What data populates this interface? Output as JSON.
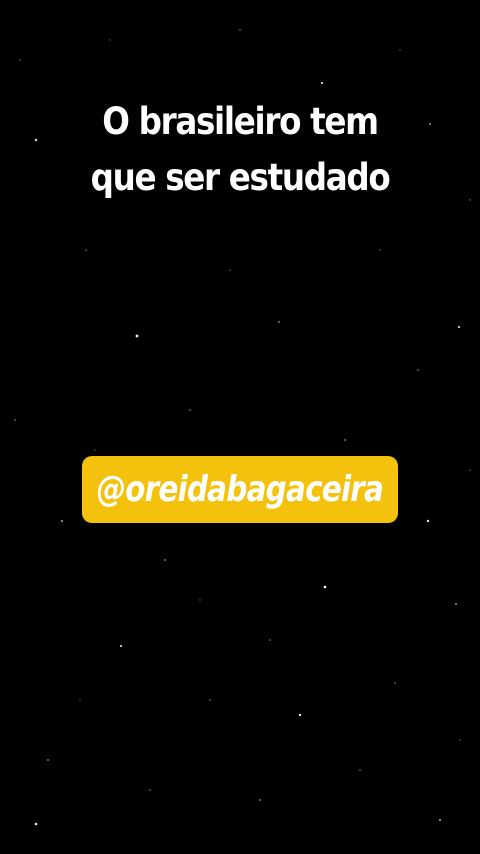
{
  "background_color": "#000000",
  "headline": {
    "line1": "O brasileiro tem",
    "line2": "que ser estudado"
  },
  "handle": {
    "text": "@oreidabagaceira",
    "badge_color": "#f4c20d"
  }
}
